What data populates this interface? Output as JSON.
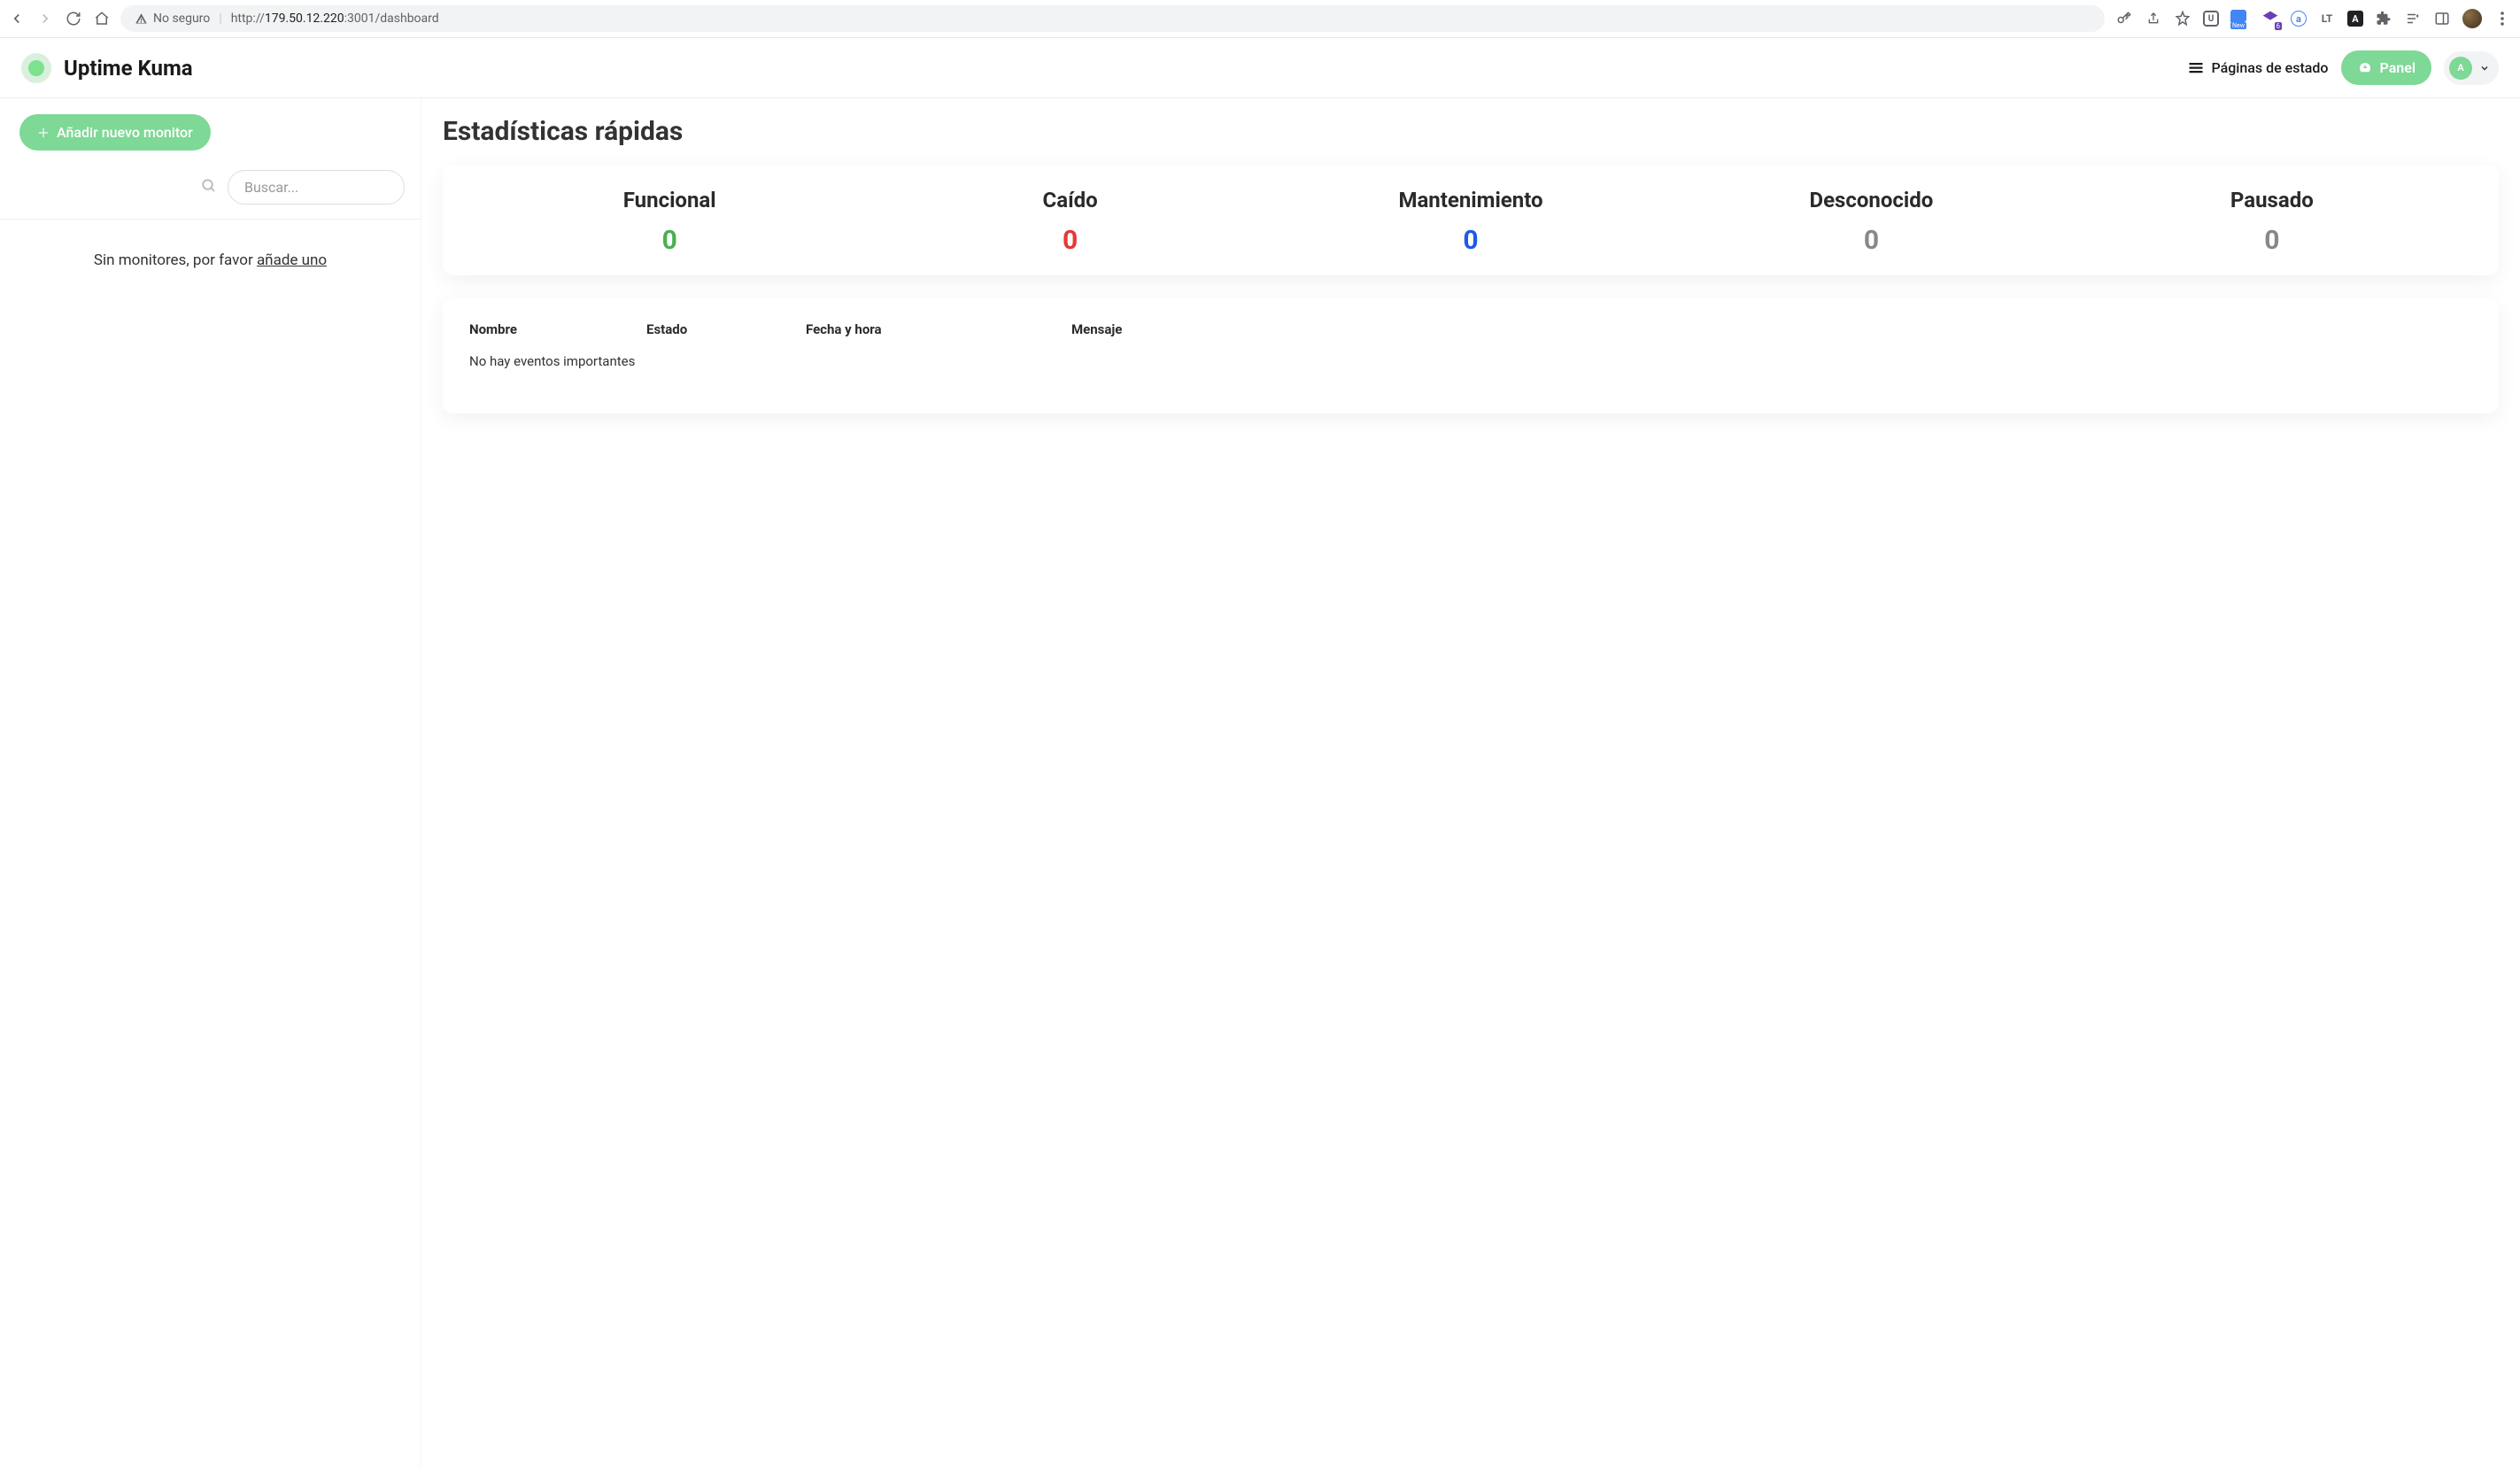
{
  "browser": {
    "not_secure": "No seguro",
    "url_prefix": "http://",
    "url_host": "179.50.12.220",
    "url_port_path": ":3001/dashboard"
  },
  "header": {
    "app_title": "Uptime Kuma",
    "status_pages": "Páginas de estado",
    "panel_btn": "Panel",
    "user_initial": "A"
  },
  "sidebar": {
    "add_monitor": "Añadir nuevo monitor",
    "search_placeholder": "Buscar...",
    "no_monitors_prefix": "Sin monitores, por favor ",
    "no_monitors_link": "añade uno"
  },
  "content": {
    "title": "Estadísticas rápidas",
    "stats": {
      "funcional_label": "Funcional",
      "funcional_value": "0",
      "caido_label": "Caído",
      "caido_value": "0",
      "mantenimiento_label": "Mantenimiento",
      "mantenimiento_value": "0",
      "desconocido_label": "Desconocido",
      "desconocido_value": "0",
      "pausado_label": "Pausado",
      "pausado_value": "0"
    },
    "events": {
      "col_nombre": "Nombre",
      "col_estado": "Estado",
      "col_fecha": "Fecha y hora",
      "col_mensaje": "Mensaje",
      "empty": "No hay eventos importantes"
    }
  }
}
